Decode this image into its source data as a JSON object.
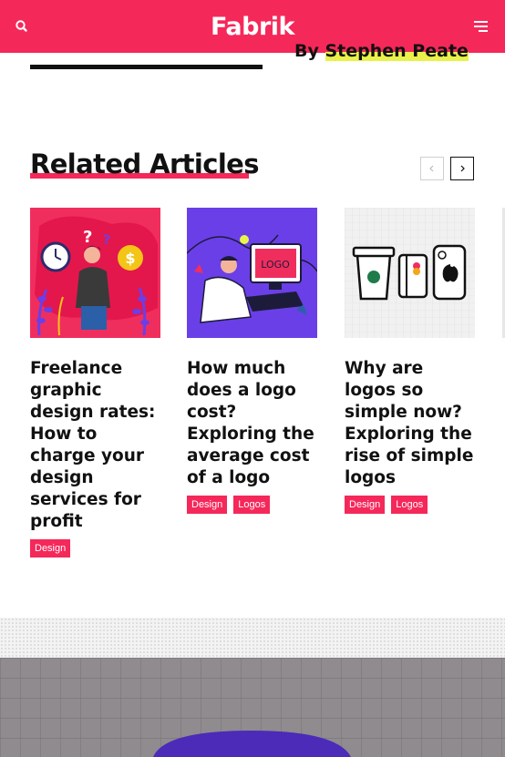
{
  "header": {
    "logo": "Fabrik",
    "search_icon": "search-icon",
    "menu_icon": "hamburger-menu-icon",
    "brand_color": "#f5285a"
  },
  "author": {
    "prefix": "By",
    "name": "Stephen Peate",
    "highlight_color": "#e8f24a"
  },
  "related": {
    "title": "Related Articles",
    "prev_icon": "chevron-left-icon",
    "next_icon": "chevron-right-icon",
    "articles": [
      {
        "title": "Freelance graphic design rates: How to charge your design services for profit",
        "image": "freelancer-illustration",
        "tags": [
          "Design"
        ]
      },
      {
        "title": "How much does a logo cost? Exploring the average cost of a logo",
        "image": "logo-designer-illustration",
        "tags": [
          "Design",
          "Logos"
        ]
      },
      {
        "title": "Why are logos so simple now? Exploring the rise of simple logos",
        "image": "simple-logos-illustration",
        "tags": [
          "Design",
          "Logos"
        ]
      }
    ]
  }
}
